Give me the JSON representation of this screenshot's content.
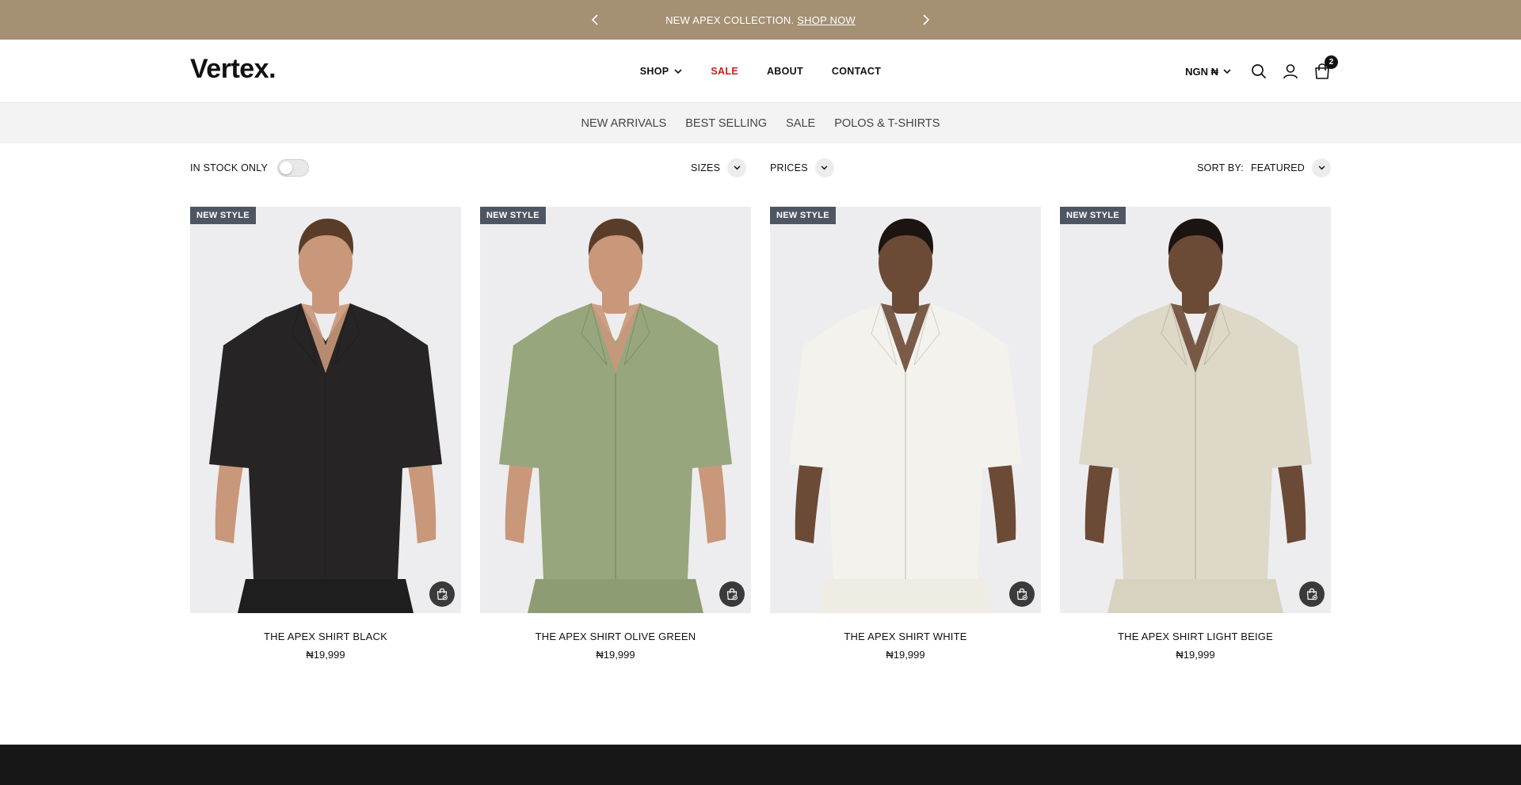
{
  "announcement": {
    "text": "NEW APEX COLLECTION.",
    "link": "SHOP NOW",
    "color": "#a59073"
  },
  "header": {
    "logo": "Vertex.",
    "nav": [
      {
        "label": "SHOP",
        "has_dropdown": true
      },
      {
        "label": "SALE",
        "color": "#c91c1c"
      },
      {
        "label": "ABOUT"
      },
      {
        "label": "CONTACT"
      }
    ],
    "currency": "NGN ₦",
    "cart_count": "2"
  },
  "subnav": [
    "NEW ARRIVALS",
    "BEST SELLING",
    "SALE",
    "POLOS & T-SHIRTS"
  ],
  "filters": {
    "in_stock_label": "IN STOCK ONLY",
    "in_stock_on": false,
    "sizes_label": "SIZES",
    "prices_label": "PRICES",
    "sort_label": "SORT BY:",
    "sort_value": "FEATURED"
  },
  "products": [
    {
      "badge": "NEW STYLE",
      "title": "THE APEX SHIRT BLACK",
      "price": "₦19,999",
      "shirt_color": "#262424",
      "bottom_color": "#1f1e1e"
    },
    {
      "badge": "NEW STYLE",
      "title": "THE APEX SHIRT OLIVE GREEN",
      "price": "₦19,999",
      "shirt_color": "#97a67c",
      "bottom_color": "#8e9c74"
    },
    {
      "badge": "NEW STYLE",
      "title": "THE APEX SHIRT WHITE",
      "price": "₦19,999",
      "shirt_color": "#f4f2ec",
      "bottom_color": "#efece4"
    },
    {
      "badge": "NEW STYLE",
      "title": "THE APEX SHIRT LIGHT BEIGE",
      "price": "₦19,999",
      "shirt_color": "#ddd8c8",
      "bottom_color": "#d8d2c0"
    }
  ]
}
